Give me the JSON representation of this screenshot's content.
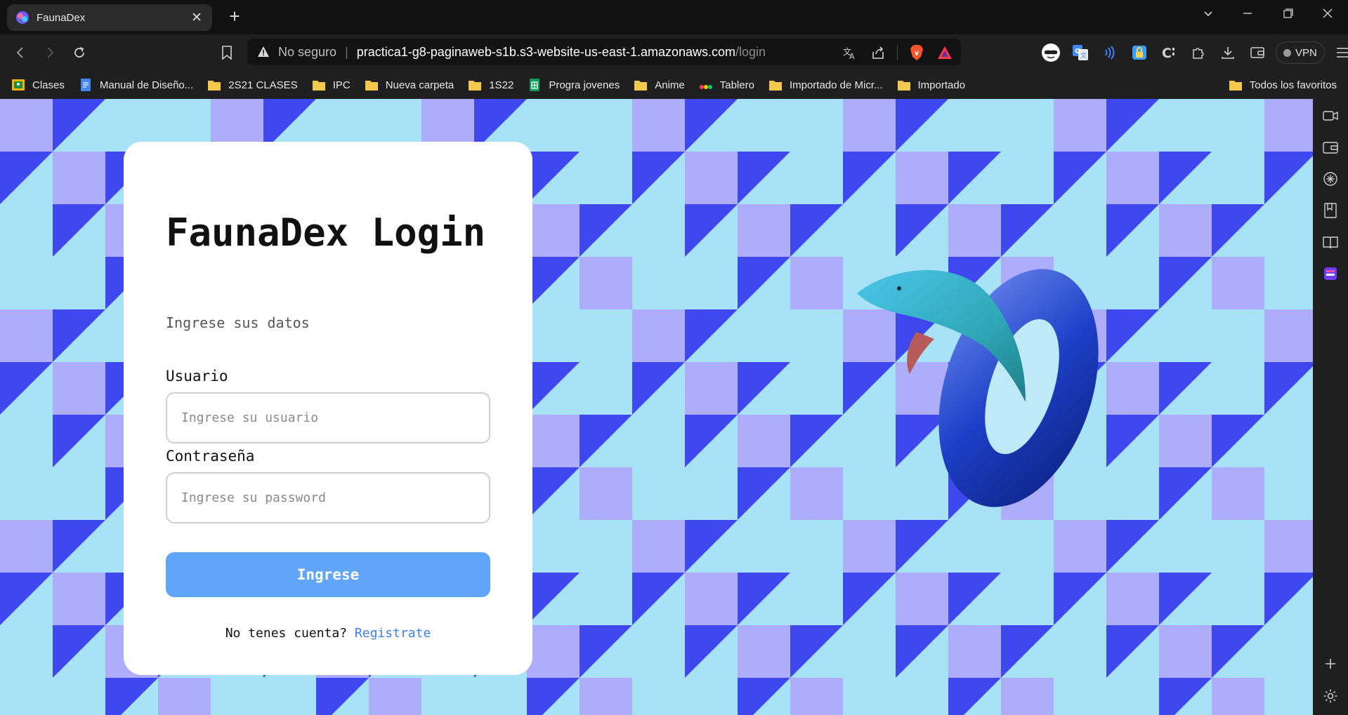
{
  "browser": {
    "tab": {
      "title": "FaunaDex"
    },
    "address": {
      "security_label": "No seguro",
      "separator": "|",
      "host": "practica1-g8-paginaweb-s1b.s3-website-us-east-1.amazonaws.com",
      "path": "/login"
    },
    "vpn_label": "VPN",
    "bookmarks": [
      {
        "label": "Clases",
        "icon": "classroom-icon"
      },
      {
        "label": "Manual de Diseño...",
        "icon": "docs-icon"
      },
      {
        "label": "2S21 CLASES",
        "icon": "folder-icon"
      },
      {
        "label": "IPC",
        "icon": "folder-icon"
      },
      {
        "label": "Nueva carpeta",
        "icon": "folder-icon"
      },
      {
        "label": "1S22",
        "icon": "folder-icon"
      },
      {
        "label": "Progra jovenes",
        "icon": "sheets-icon"
      },
      {
        "label": "Anime",
        "icon": "folder-icon"
      },
      {
        "label": "Tablero",
        "icon": "monday-icon"
      },
      {
        "label": "Importado de Micr...",
        "icon": "folder-icon"
      },
      {
        "label": "Importado",
        "icon": "folder-icon"
      }
    ],
    "all_bookmarks_label": "Todos los favoritos"
  },
  "login": {
    "title": "FaunaDex Login",
    "subtitle": "Ingrese sus datos",
    "user_label": "Usuario",
    "user_placeholder": "Ingrese su usuario",
    "password_label": "Contraseña",
    "password_placeholder": "Ingrese su password",
    "submit_label": "Ingrese",
    "footer_text": "No tenes cuenta? ",
    "register_link": "Registrate"
  },
  "colors": {
    "background_light": "#a8e2f7",
    "pattern_lavender": "#adadfb",
    "pattern_blue": "#3f48ee",
    "button": "#60a5fa",
    "link": "#3b82f6"
  }
}
